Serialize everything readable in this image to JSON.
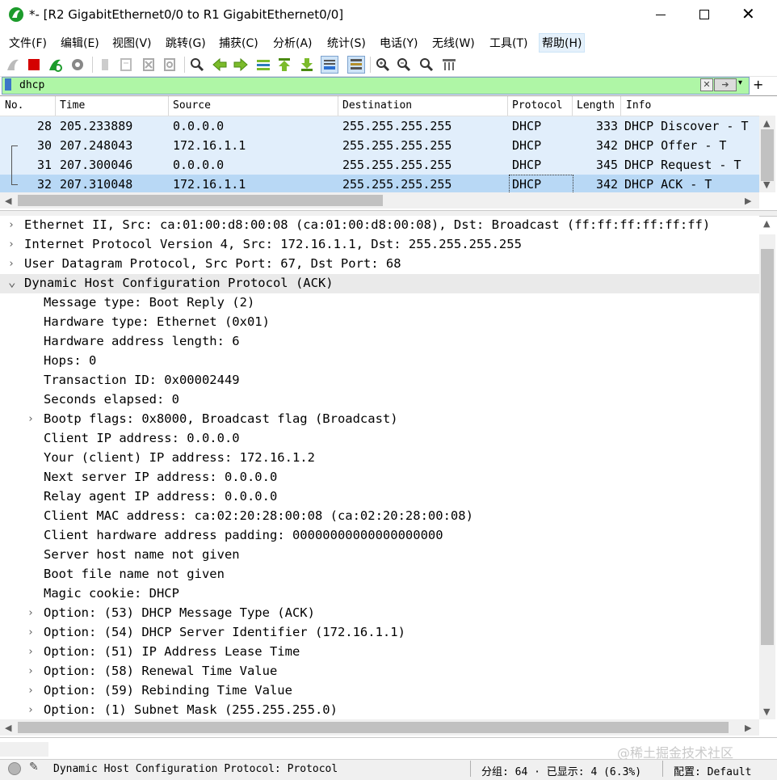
{
  "window": {
    "title": "*- [R2 GigabitEthernet0/0 to R1 GigabitEthernet0/0]",
    "close_glyph": "✕"
  },
  "menu": [
    "文件(F)",
    "编辑(E)",
    "视图(V)",
    "跳转(G)",
    "捕获(C)",
    "分析(A)",
    "统计(S)",
    "电话(Y)",
    "无线(W)",
    "工具(T)",
    "帮助(H)"
  ],
  "toolbar": {
    "icons": [
      "shark-fin-start-icon",
      "stop-capture-icon",
      "restart-capture-icon",
      "capture-options-icon",
      "open-file-icon",
      "save-file-icon",
      "close-file-icon",
      "reload-file-icon",
      "find-packet-icon",
      "go-back-icon",
      "go-forward-icon",
      "go-to-packet-icon",
      "go-first-icon",
      "go-last-icon",
      "autoscroll-icon",
      "colorize-icon",
      "zoom-in-icon",
      "zoom-out-icon",
      "zoom-normal-icon",
      "resize-columns-icon"
    ]
  },
  "filter": {
    "value": "dhcp",
    "dropdown_glyph": "▾",
    "add_glyph": "+"
  },
  "packet_list": {
    "columns": [
      "No.",
      "Time",
      "Source",
      "Destination",
      "Protocol",
      "Length",
      "Info"
    ],
    "rows": [
      {
        "no": "28",
        "time": "205.233889",
        "source": "0.0.0.0",
        "destination": "255.255.255.255",
        "protocol": "DHCP",
        "length": "333",
        "info": "DHCP Discover  - T"
      },
      {
        "no": "30",
        "time": "207.248043",
        "source": "172.16.1.1",
        "destination": "255.255.255.255",
        "protocol": "DHCP",
        "length": "342",
        "info": "DHCP Offer     - T"
      },
      {
        "no": "31",
        "time": "207.300046",
        "source": "0.0.0.0",
        "destination": "255.255.255.255",
        "protocol": "DHCP",
        "length": "345",
        "info": "DHCP Request   - T"
      },
      {
        "no": "32",
        "time": "207.310048",
        "source": "172.16.1.1",
        "destination": "255.255.255.255",
        "protocol": "DHCP",
        "length": "342",
        "info": "DHCP ACK       - T"
      }
    ],
    "selected_row_index": 3
  },
  "details": [
    {
      "indent": 0,
      "expander": "collapsed",
      "text": "Ethernet II, Src: ca:01:00:d8:00:08 (ca:01:00:d8:00:08), Dst: Broadcast (ff:ff:ff:ff:ff:ff)"
    },
    {
      "indent": 0,
      "expander": "collapsed",
      "text": "Internet Protocol Version 4, Src: 172.16.1.1, Dst: 255.255.255.255"
    },
    {
      "indent": 0,
      "expander": "collapsed",
      "text": "User Datagram Protocol, Src Port: 67, Dst Port: 68"
    },
    {
      "indent": 0,
      "expander": "expanded",
      "text": "Dynamic Host Configuration Protocol (ACK)",
      "highlighted": true
    },
    {
      "indent": 1,
      "expander": "none",
      "text": "Message type: Boot Reply (2)"
    },
    {
      "indent": 1,
      "expander": "none",
      "text": "Hardware type: Ethernet (0x01)"
    },
    {
      "indent": 1,
      "expander": "none",
      "text": "Hardware address length: 6"
    },
    {
      "indent": 1,
      "expander": "none",
      "text": "Hops: 0"
    },
    {
      "indent": 1,
      "expander": "none",
      "text": "Transaction ID: 0x00002449"
    },
    {
      "indent": 1,
      "expander": "none",
      "text": "Seconds elapsed: 0"
    },
    {
      "indent": 1,
      "expander": "collapsed",
      "text": "Bootp flags: 0x8000, Broadcast flag (Broadcast)"
    },
    {
      "indent": 1,
      "expander": "none",
      "text": "Client IP address: 0.0.0.0"
    },
    {
      "indent": 1,
      "expander": "none",
      "text": "Your (client) IP address: 172.16.1.2"
    },
    {
      "indent": 1,
      "expander": "none",
      "text": "Next server IP address: 0.0.0.0"
    },
    {
      "indent": 1,
      "expander": "none",
      "text": "Relay agent IP address: 0.0.0.0"
    },
    {
      "indent": 1,
      "expander": "none",
      "text": "Client MAC address: ca:02:20:28:00:08 (ca:02:20:28:00:08)"
    },
    {
      "indent": 1,
      "expander": "none",
      "text": "Client hardware address padding: 00000000000000000000"
    },
    {
      "indent": 1,
      "expander": "none",
      "text": "Server host name not given"
    },
    {
      "indent": 1,
      "expander": "none",
      "text": "Boot file name not given"
    },
    {
      "indent": 1,
      "expander": "none",
      "text": "Magic cookie: DHCP"
    },
    {
      "indent": 1,
      "expander": "collapsed",
      "text": "Option: (53) DHCP Message Type (ACK)"
    },
    {
      "indent": 1,
      "expander": "collapsed",
      "text": "Option: (54) DHCP Server Identifier (172.16.1.1)"
    },
    {
      "indent": 1,
      "expander": "collapsed",
      "text": "Option: (51) IP Address Lease Time"
    },
    {
      "indent": 1,
      "expander": "collapsed",
      "text": "Option: (58) Renewal Time Value"
    },
    {
      "indent": 1,
      "expander": "collapsed",
      "text": "Option: (59) Rebinding Time Value"
    },
    {
      "indent": 1,
      "expander": "collapsed",
      "text": "Option: (1) Subnet Mask (255.255.255.0)"
    }
  ],
  "status": {
    "text": "Dynamic Host Configuration Protocol: Protocol",
    "packets": "分组: 64 · 已显示: 4 (6.3%)",
    "profile": "配置: Default"
  },
  "watermark": "@稀土掘金技术社区",
  "colors": {
    "filter_valid_bg": "#aff6a6",
    "row_bg": "#e1eefb",
    "row_selected_bg": "#b8d8f5",
    "detail_highlight_bg": "#eaeaea",
    "stop_button": "#d40000",
    "shark_fin": "#1c9b2b"
  }
}
